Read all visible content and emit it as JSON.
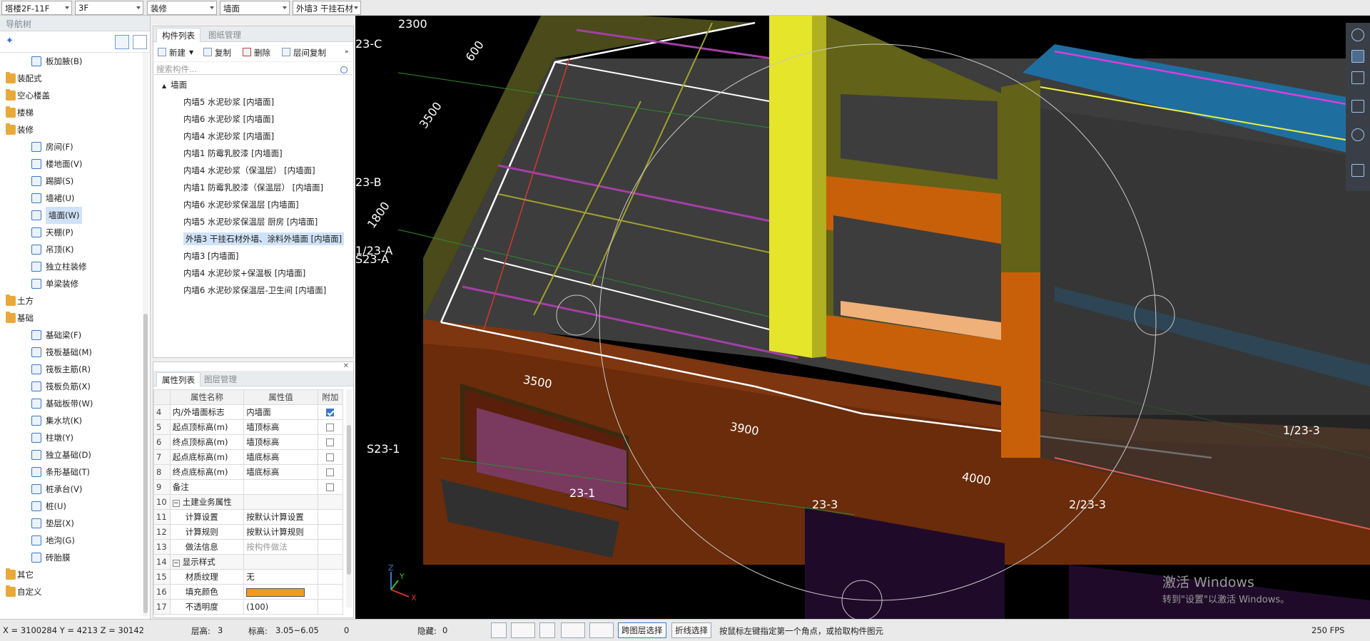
{
  "toolbar": {
    "floor_range": "塔楼2F-11F",
    "floor": "3F",
    "category": "装修",
    "element_type": "墙面",
    "element_name": "外墙3 干挂石材"
  },
  "nav": {
    "title": "导航树",
    "items": [
      {
        "label": "板加腋(B)",
        "icon": "slab-haunch-icon",
        "indent": 2
      },
      {
        "label": "装配式",
        "icon": "folder-icon",
        "indent": 1
      },
      {
        "label": "空心楼盖",
        "icon": "folder-icon",
        "indent": 1
      },
      {
        "label": "楼梯",
        "icon": "folder-icon",
        "indent": 1
      },
      {
        "label": "装修",
        "icon": "folder-icon",
        "indent": 1
      },
      {
        "label": "房间(F)",
        "icon": "room-icon",
        "indent": 2
      },
      {
        "label": "楼地面(V)",
        "icon": "floor-icon",
        "indent": 2
      },
      {
        "label": "踢脚(S)",
        "icon": "skirting-icon",
        "indent": 2
      },
      {
        "label": "墙裙(U)",
        "icon": "dado-icon",
        "indent": 2
      },
      {
        "label": "墙面(W)",
        "icon": "wall-face-icon",
        "indent": 2,
        "selected": true
      },
      {
        "label": "天棚(P)",
        "icon": "ceiling-icon",
        "indent": 2
      },
      {
        "label": "吊顶(K)",
        "icon": "suspended-ceiling-icon",
        "indent": 2
      },
      {
        "label": "独立柱装修",
        "icon": "column-finish-icon",
        "indent": 2
      },
      {
        "label": "单梁装修",
        "icon": "beam-finish-icon",
        "indent": 2
      },
      {
        "label": "土方",
        "icon": "folder-icon",
        "indent": 1
      },
      {
        "label": "基础",
        "icon": "folder-icon",
        "indent": 1
      },
      {
        "label": "基础梁(F)",
        "icon": "foundation-beam-icon",
        "indent": 2
      },
      {
        "label": "筏板基础(M)",
        "icon": "raft-icon",
        "indent": 2
      },
      {
        "label": "筏板主筋(R)",
        "icon": "raft-rebar-icon",
        "indent": 2
      },
      {
        "label": "筏板负筋(X)",
        "icon": "raft-neg-rebar-icon",
        "indent": 2
      },
      {
        "label": "基础板带(W)",
        "icon": "strip-icon",
        "indent": 2
      },
      {
        "label": "集水坑(K)",
        "icon": "sump-icon",
        "indent": 2
      },
      {
        "label": "柱墩(Y)",
        "icon": "pier-icon",
        "indent": 2
      },
      {
        "label": "独立基础(D)",
        "icon": "isolated-footing-icon",
        "indent": 2
      },
      {
        "label": "条形基础(T)",
        "icon": "strip-footing-icon",
        "indent": 2
      },
      {
        "label": "桩承台(V)",
        "icon": "pile-cap-icon",
        "indent": 2
      },
      {
        "label": "桩(U)",
        "icon": "pile-icon",
        "indent": 2
      },
      {
        "label": "垫层(X)",
        "icon": "cushion-icon",
        "indent": 2
      },
      {
        "label": "地沟(G)",
        "icon": "trench-icon",
        "indent": 2
      },
      {
        "label": "砖胎膜",
        "icon": "brick-form-icon",
        "indent": 2
      },
      {
        "label": "其它",
        "icon": "folder-icon",
        "indent": 1
      },
      {
        "label": "自定义",
        "icon": "folder-icon",
        "indent": 1
      }
    ]
  },
  "component_panel": {
    "tab_active": "构件列表",
    "tab_other": "图纸管理",
    "new_label": "新建",
    "copy_label": "复制",
    "delete_label": "删除",
    "floor_copy_label": "层间复制",
    "search_placeholder": "搜索构件...",
    "root": "墙面",
    "items": [
      "内墙5 水泥砂浆 [内墙面]",
      "内墙6 水泥砂浆 [内墙面]",
      "内墙4 水泥砂浆 [内墙面]",
      "内墙1 防霉乳胶漆 [内墙面]",
      "内墙4 水泥砂浆（保温层） [内墙面]",
      "内墙1 防霉乳胶漆（保温层） [内墙面]",
      "内墙6 水泥砂浆保温层 [内墙面]",
      "内墙5 水泥砂浆保温层 厨房 [内墙面]",
      "外墙3 干挂石材外墙、涂料外墙面 [内墙面]",
      "内墙3 [内墙面]",
      "内墙4 水泥砂浆+保温板 [内墙面]",
      "内墙6 水泥砂浆保温层-卫生间 [内墙面]"
    ],
    "selected_index": 8
  },
  "property_panel": {
    "tab_active": "属性列表",
    "tab_other": "图层管理",
    "headers": [
      "属性名称",
      "属性值",
      "附加"
    ],
    "rows": [
      {
        "n": "4",
        "k": "内/外墙面标志",
        "v": "内墙面",
        "cb": "on"
      },
      {
        "n": "5",
        "k": "起点顶标高(m)",
        "v": "墙顶标高",
        "cb": "off"
      },
      {
        "n": "6",
        "k": "终点顶标高(m)",
        "v": "墙顶标高",
        "cb": "off"
      },
      {
        "n": "7",
        "k": "起点底标高(m)",
        "v": "墙底标高",
        "cb": "off"
      },
      {
        "n": "8",
        "k": "终点底标高(m)",
        "v": "墙底标高",
        "cb": "off"
      },
      {
        "n": "9",
        "k": "备注",
        "v": "",
        "cb": "off"
      },
      {
        "n": "10",
        "k": "土建业务属性",
        "v": "",
        "cb": "none",
        "group": true
      },
      {
        "n": "11",
        "k": "计算设置",
        "v": "按默认计算设置",
        "cb": "none",
        "sub": true
      },
      {
        "n": "12",
        "k": "计算规则",
        "v": "按默认计算规则",
        "cb": "none",
        "sub": true
      },
      {
        "n": "13",
        "k": "做法信息",
        "v": "按构件做法",
        "cb": "none",
        "sub": true,
        "muted": true
      },
      {
        "n": "14",
        "k": "显示样式",
        "v": "",
        "cb": "none",
        "group": true
      },
      {
        "n": "15",
        "k": "材质纹理",
        "v": "无",
        "cb": "none",
        "sub": true
      },
      {
        "n": "16",
        "k": "填充颜色",
        "v": "",
        "cb": "none",
        "sub": true,
        "swatch": "#f39a1f"
      },
      {
        "n": "17",
        "k": "不透明度",
        "v": "(100)",
        "cb": "none",
        "sub": true
      }
    ]
  },
  "viewport": {
    "axis_labels": [
      "23-C",
      "23-B",
      "1/23-A",
      "S23-A",
      "S23-1",
      "23-1",
      "23-3",
      "2/23-3",
      "1/23-3",
      "S23-1"
    ],
    "dimensions": [
      "2300",
      "600",
      "3500",
      "1800",
      "3500",
      "3900",
      "4000"
    ],
    "watermark_title": "激活 Windows",
    "watermark_sub": "转到\"设置\"以激活 Windows。",
    "fps": "250 FPS"
  },
  "statusbar": {
    "coords": "X = 3100284 Y = 4213 Z = 30142",
    "floor_height_label": "层高:",
    "floor_height": "3",
    "elevation_label": "标高:",
    "elevation": "3.05~6.05",
    "zero": "0",
    "hidden_label": "隐藏:",
    "hidden": "0",
    "cross_layer": "跨图层选择",
    "polyline_select": "折线选择",
    "hint": "按鼠标左键指定第一个角点，或拾取构件图元",
    "fps": "250 FPS"
  }
}
